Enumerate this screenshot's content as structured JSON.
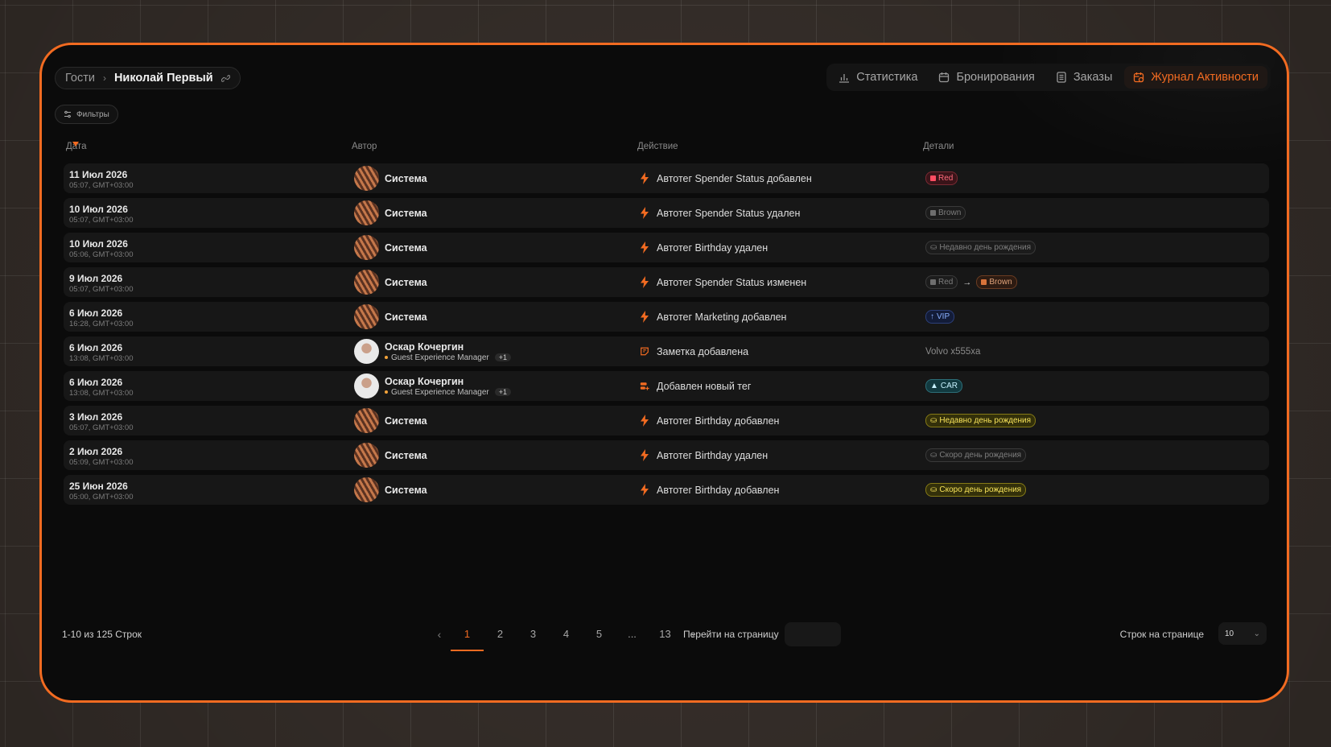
{
  "breadcrumb": {
    "root": "Гости",
    "current": "Николай Первый"
  },
  "tabs": [
    {
      "label": "Статистика",
      "icon": "bar-chart-icon"
    },
    {
      "label": "Бронирования",
      "icon": "calendar-icon"
    },
    {
      "label": "Заказы",
      "icon": "list-icon"
    },
    {
      "label": "Журнал Активности",
      "icon": "calendar-clock-icon",
      "active": true
    }
  ],
  "filters_label": "Фильтры",
  "table": {
    "headers": {
      "date": "Дата",
      "author": "Автор",
      "action": "Действие",
      "details": "Детали"
    },
    "rows": [
      {
        "date": "11 Июл 2026",
        "time": "05:07, GMT+03:00",
        "author": "Система",
        "action": "Автотег Spender Status добавлен"
      },
      {
        "date": "10 Июл 2026",
        "time": "05:07, GMT+03:00",
        "author": "Система",
        "action": "Автотег Spender Status удален"
      },
      {
        "date": "10 Июл 2026",
        "time": "05:06, GMT+03:00",
        "author": "Система",
        "action": "Автотег Birthday удален"
      },
      {
        "date": "9 Июл 2026",
        "time": "05:07, GMT+03:00",
        "author": "Система",
        "action": "Автотег Spender Status изменен"
      },
      {
        "date": "6 Июл 2026",
        "time": "16:28, GMT+03:00",
        "author": "Система",
        "action": "Автотег Marketing добавлен"
      },
      {
        "date": "6 Июл 2026",
        "time": "13:08, GMT+03:00",
        "author": "Оскар Кочергин",
        "role": "Guest Experience Manager",
        "extra": "+1",
        "action": "Заметка добавлена"
      },
      {
        "date": "6 Июл 2026",
        "time": "13:08, GMT+03:00",
        "author": "Оскар Кочергин",
        "role": "Guest Experience Manager",
        "extra": "+1",
        "action": "Добавлен новый тег"
      },
      {
        "date": "3 Июл 2026",
        "time": "05:07, GMT+03:00",
        "author": "Система",
        "action": "Автотег Birthday добавлен"
      },
      {
        "date": "2 Июл 2026",
        "time": "05:09, GMT+03:00",
        "author": "Система",
        "action": "Автотег Birthday удален"
      },
      {
        "date": "25 Июн 2026",
        "time": "05:00, GMT+03:00",
        "author": "Система",
        "action": "Автотег Birthday добавлен"
      }
    ],
    "details": {
      "r0": "Red",
      "r1": "Brown",
      "r2": "Недавно день рождения",
      "r3_from": "Red",
      "r3_arrow": "→",
      "r3_to": "Brown",
      "r4": "VIP",
      "r5": "Volvo x555xa",
      "r6": "CAR",
      "r7": "Недавно день рождения",
      "r8": "Скоро день рождения",
      "r9": "Скоро день рождения"
    }
  },
  "footer": {
    "rows_count": "1-10 из 125 Строк",
    "pages": [
      "1",
      "2",
      "3",
      "4",
      "5",
      "...",
      "13"
    ],
    "current_page": "1",
    "goto_label": "Перейти на страницу",
    "per_page_label": "Строк на странице",
    "per_page_value": "10"
  },
  "colors": {
    "accent": "#f26b21",
    "background": "#0b0b0b"
  }
}
